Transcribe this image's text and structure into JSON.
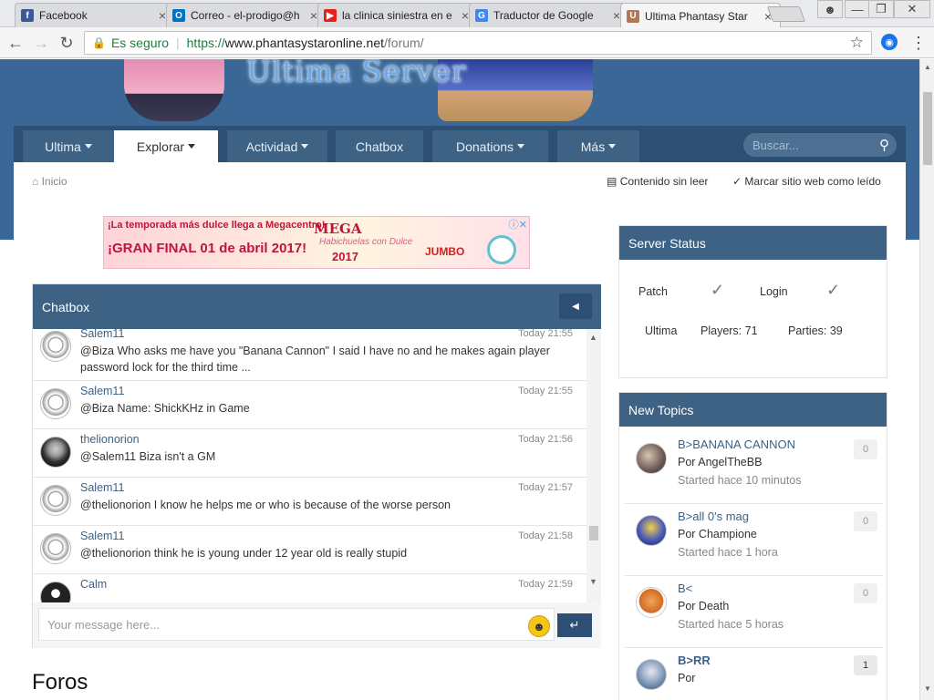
{
  "browser": {
    "tabs": [
      {
        "title": "Facebook",
        "favicon": "f",
        "color": "#3b5998"
      },
      {
        "title": "Correo - el-prodigo@h",
        "favicon": "O",
        "color": "#0072c6"
      },
      {
        "title": "la clinica siniestra en e",
        "favicon": "▶",
        "color": "#e62117"
      },
      {
        "title": "Traductor de Google",
        "favicon": "G",
        "color": "#4285f4"
      },
      {
        "title": "Ultima Phantasy Star",
        "favicon": "U",
        "color": "#b07858"
      }
    ],
    "close_glyph": "×",
    "secure_label": "Es seguro",
    "url_scheme": "https://",
    "url_host": "www.phantasystaronline.net",
    "url_path": "/forum/"
  },
  "site": {
    "logo_text": "Ultima Server"
  },
  "nav": {
    "items": [
      "Ultima",
      "Explorar",
      "Actividad",
      "Chatbox",
      "Donations",
      "Más"
    ],
    "search_placeholder": "Buscar..."
  },
  "breadcrumb": {
    "home": "Inicio"
  },
  "actions": {
    "unread": "Contenido sin leer",
    "mark_read": "Marcar sitio web como leído"
  },
  "ad": {
    "line1": "¡La temporada más dulce llega a Megacentro!",
    "line2": "¡GRAN FINAL 01 de abril 2017!",
    "brand": "MEGA",
    "tagline": "Habichuelas con Dulce",
    "year": "2017",
    "jumbo": "JUMBO"
  },
  "chatbox": {
    "title": "Chatbox",
    "input_placeholder": "Your message here...",
    "messages": [
      {
        "user": "Salem11",
        "time": "Today 21:55",
        "text": "@Biza Who asks me have you \"Banana Cannon\" I said I have no and he makes again player password lock for the third time ..."
      },
      {
        "user": "Salem11",
        "time": "Today 21:55",
        "text": "@Biza Name: ShickKHz in Game"
      },
      {
        "user": "thelionorion",
        "time": "Today 21:56",
        "text": "@Salem11 Biza isn't a GM"
      },
      {
        "user": "Salem11",
        "time": "Today 21:57",
        "text": "@thelionorion I know he helps me or who is because of the worse person"
      },
      {
        "user": "Salem11",
        "time": "Today 21:58",
        "text": "@thelionorion think he is young under 12 year old is really stupid"
      },
      {
        "user": "Calm",
        "time": "Today 21:59",
        "text": ""
      }
    ]
  },
  "foros_title": "Foros",
  "server_status": {
    "title": "Server Status",
    "patch": "Patch",
    "login": "Login",
    "ultima": "Ultima",
    "players": "Players: 71",
    "parties": "Parties: 39"
  },
  "new_topics": {
    "title": "New Topics",
    "items": [
      {
        "title": "B>BANANA CANNON",
        "by": "Por AngelTheBB",
        "started": "Started hace 10 minutos",
        "count": "0"
      },
      {
        "title": "B>all 0's mag",
        "by": "Por Champione",
        "started": "Started hace 1 hora",
        "count": "0"
      },
      {
        "title": "B<",
        "by": "Por Death",
        "started": "Started hace 5 horas",
        "count": "0"
      },
      {
        "title": "B>RR",
        "by": "Por",
        "started": "",
        "count": "1"
      }
    ]
  }
}
